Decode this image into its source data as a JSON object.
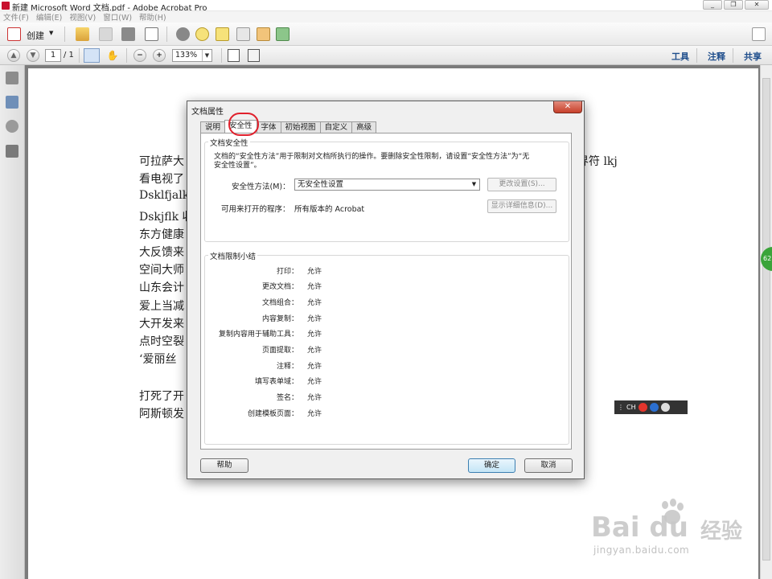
{
  "window": {
    "title": "新建 Microsoft Word 文档.pdf - Adobe Acrobat Pro",
    "buttons": [
      "_",
      "❐",
      "✕"
    ]
  },
  "menu": [
    "文件(F)",
    "编辑(E)",
    "视图(V)",
    "窗口(W)",
    "帮助(H)"
  ],
  "toolbar": {
    "create_label": "创建",
    "page_current": "1",
    "page_total": "/ 1",
    "zoom": "133%",
    "right_links": [
      "工具",
      "注释",
      "共享"
    ]
  },
  "document": {
    "lines": [
      "可拉萨大",
      "看电视了",
      "Dsklfjalkd",
      "Dskjflk 收",
      "东方健康",
      "大反馈来",
      "空间大师",
      "山东会计",
      "爱上当减",
      "大开发来",
      "点时空裂",
      "‘爱丽丝",
      "",
      "打死了开",
      "阿斯顿发"
    ],
    "right_fragment": "界符 lkj"
  },
  "ime_bar": {
    "label": "CH"
  },
  "side_badge": "62",
  "dialog": {
    "title": "文档属性",
    "close": "✕",
    "tabs": [
      "说明",
      "安全性",
      "字体",
      "初始视图",
      "自定义",
      "高级"
    ],
    "active_tab": "安全性",
    "security_group": {
      "title": "文档安全性",
      "description": "文档的“安全性方法”用于限制对文档所执行的操作。要删除安全性限制，请设置“安全性方法”为“无安全性设置”。",
      "method_label": "安全性方法(M)：",
      "method_value": "无安全性设置",
      "change_button": "更改设置(S)...",
      "open_label": "可用来打开的程序：",
      "open_value": "所有版本的 Acrobat",
      "details_button": "显示详细信息(D)..."
    },
    "restrictions_group": {
      "title": "文档限制小结",
      "rows": [
        {
          "label": "打印：",
          "value": "允许"
        },
        {
          "label": "更改文档：",
          "value": "允许"
        },
        {
          "label": "文档组合：",
          "value": "允许"
        },
        {
          "label": "内容复制：",
          "value": "允许"
        },
        {
          "label": "复制内容用于辅助工具：",
          "value": "允许"
        },
        {
          "label": "页面提取：",
          "value": "允许"
        },
        {
          "label": "注释：",
          "value": "允许"
        },
        {
          "label": "填写表单域：",
          "value": "允许"
        },
        {
          "label": "签名：",
          "value": "允许"
        },
        {
          "label": "创建模板页面：",
          "value": "允许"
        }
      ]
    },
    "help_button": "帮助",
    "ok_button": "确定",
    "cancel_button": "取消"
  },
  "watermark": {
    "brand": "Bai du",
    "brand_cn": "经验",
    "url": "jingyan.baidu.com"
  }
}
